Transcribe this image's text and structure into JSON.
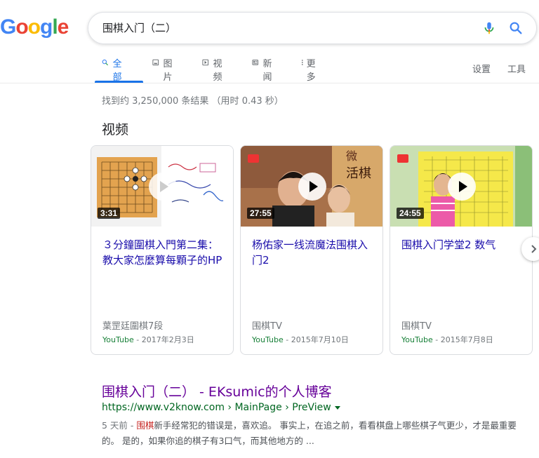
{
  "logo": {
    "letters": [
      "G",
      "o",
      "o",
      "g",
      "l",
      "e"
    ],
    "colors": [
      "#4285F4",
      "#EA4335",
      "#FBBC05",
      "#4285F4",
      "#34A853",
      "#EA4335"
    ]
  },
  "search": {
    "query": "围棋入门（二）"
  },
  "tabs": [
    {
      "label": "全部",
      "icon": "search-icon",
      "active": true
    },
    {
      "label": "图片",
      "icon": "image-icon"
    },
    {
      "label": "视频",
      "icon": "play-icon"
    },
    {
      "label": "新闻",
      "icon": "news-icon"
    },
    {
      "label": "更多",
      "icon": "more-vert-icon"
    }
  ],
  "tools": {
    "settings": "设置",
    "tools": "工具"
  },
  "result_stats": "找到约 3,250,000 条结果 （用时 0.43 秒）",
  "videos_section": {
    "title": "视频",
    "items": [
      {
        "duration": "3:31",
        "title": "３分鐘圍棋入門第二集：教大家怎麼算每顆子的HP",
        "channel": "葉罡廷圍棋7段",
        "source": "YouTube",
        "date": "2017年2月3日",
        "date_sep": " - "
      },
      {
        "duration": "27:55",
        "title": "杨佑家一线流魔法围棋入门2",
        "channel": "围棋TV",
        "source": "YouTube",
        "date": "2015年7月10日",
        "date_sep": " - "
      },
      {
        "duration": "24:55",
        "title": "围棋入门学堂2 数气",
        "channel": "围棋TV",
        "source": "YouTube",
        "date": "2015年7月8日",
        "date_sep": " - "
      }
    ]
  },
  "result": {
    "title": "围棋入门（二） - EKsumic的个人博客",
    "url": "https://www.v2know.com › MainPage › PreView",
    "snippet_date": "5 天前 - ",
    "snippet_highlight": "围棋",
    "snippet_rest": "新手经常犯的错误是，喜欢追。 事实上，在追之前，看看棋盘上哪些棋子气更少，才是最重要的。 是的，如果你追的棋子有3口气，而其他地方的 ..."
  },
  "colors": {
    "link": "#1a0dab",
    "visited": "#660099",
    "url": "#006621",
    "accent": "#1a73e8"
  }
}
